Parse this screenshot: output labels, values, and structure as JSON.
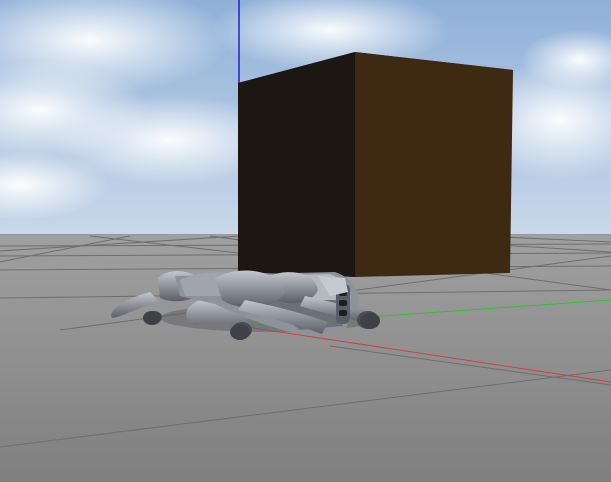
{
  "scene": {
    "description_shown": "",
    "sky_top_color": "#8fb0d8",
    "sky_bottom_color": "#c9d8ea",
    "ground_color": "#8a8a8a",
    "grid_line_color": "#6e6e6e",
    "axis_x_color": "#d04040",
    "axis_y_color": "#30c030",
    "axis_z_color": "#2020d0",
    "box_front_color": "#1c1712",
    "box_side_color": "#3e2a12",
    "robot_color": "#8e929b",
    "robot_shadow_color": "#5e626a"
  }
}
